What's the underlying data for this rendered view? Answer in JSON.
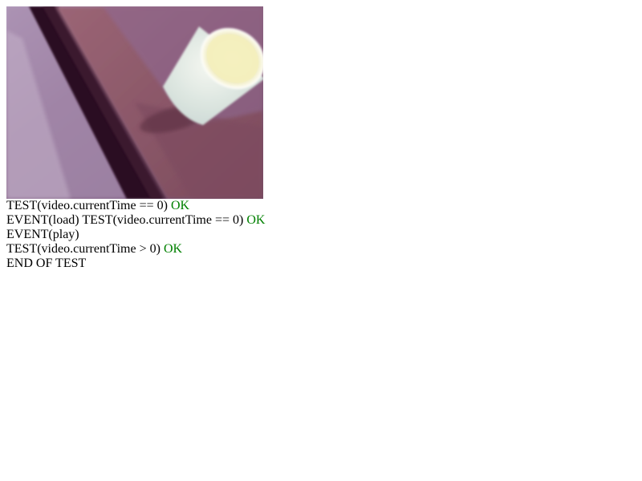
{
  "video": {
    "name": "video-element",
    "colors": {
      "base": "#7a5a7e",
      "dark_band": "#2a1020",
      "light_band": "#a98fb1",
      "table": "#8a5060",
      "cup": "#dfe9e4",
      "cup_rim": "#f7f4c6"
    }
  },
  "log": {
    "line1": {
      "text": "TEST(video.currentTime == 0) ",
      "status": "OK"
    },
    "line2": {
      "text": "EVENT(load) TEST(video.currentTime == 0) ",
      "status": "OK"
    },
    "line3": {
      "text": "EVENT(play)"
    },
    "line4": {
      "text": "TEST(video.currentTime > 0) ",
      "status": "OK"
    },
    "line5": {
      "text": "END OF TEST"
    },
    "ok_color": "#008000"
  }
}
